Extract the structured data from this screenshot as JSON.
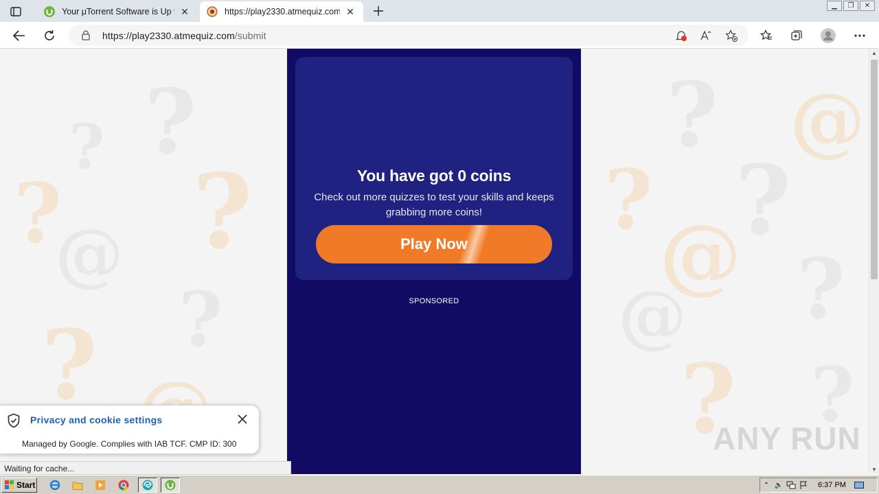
{
  "browser": {
    "tabs": [
      {
        "title": "Your μTorrent Software is Up to",
        "active": false
      },
      {
        "title": "https://play2330.atmequiz.com",
        "active": true
      }
    ],
    "address": {
      "host": "https://play2330.atmequiz.com",
      "path": "/submit"
    }
  },
  "page": {
    "headline": "You have got 0 coins",
    "subtext": "Check out more quizzes to test your skills and keeps grabbing more coins!",
    "play_button": "Play Now",
    "sponsored": "SPONSORED",
    "colors": {
      "panel": "#110b63",
      "card": "#1f2280",
      "button": "#f07a28"
    }
  },
  "privacy_popup": {
    "title": "Privacy and cookie settings",
    "description": "Managed by Google. Complies with IAB TCF. CMP ID: 300"
  },
  "status_bar": {
    "text": "Waiting for cache..."
  },
  "watermark": "ANY RUN",
  "taskbar": {
    "start_label": "Start",
    "clock": "6:37 PM"
  }
}
